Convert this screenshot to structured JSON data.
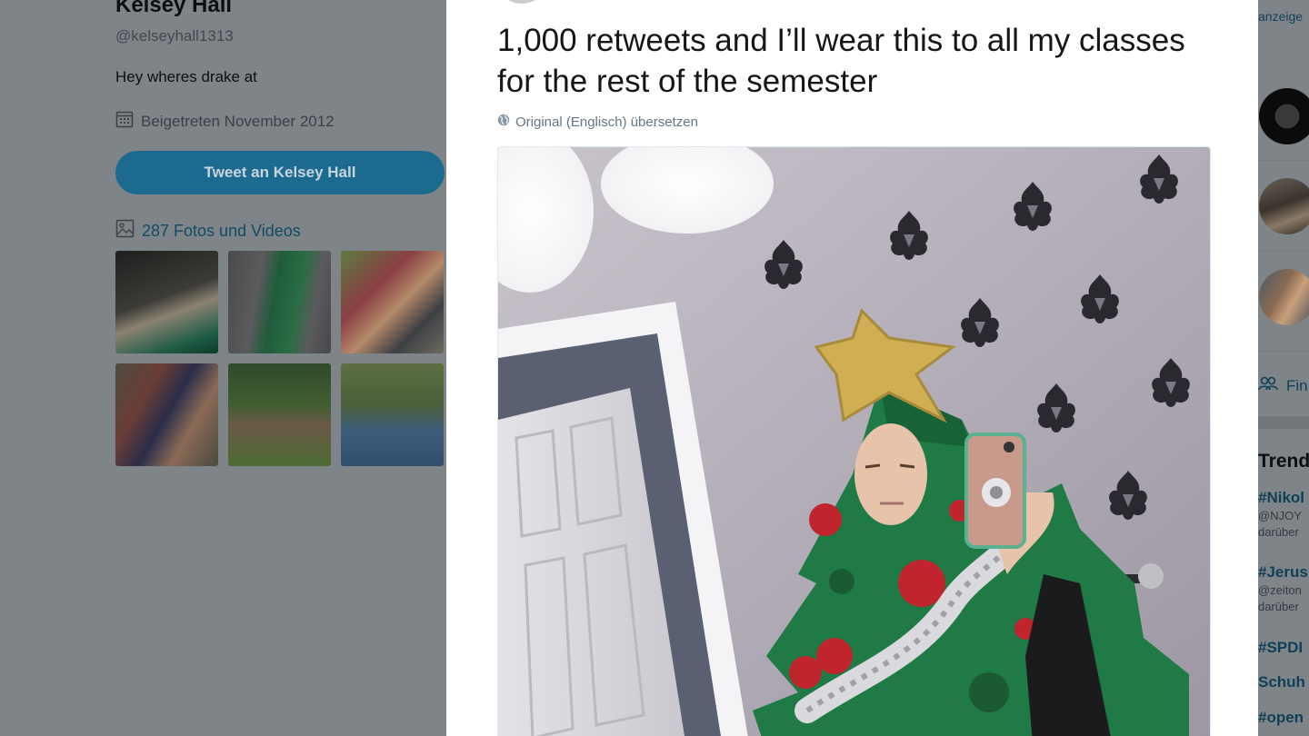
{
  "profile": {
    "name": "Kelsey Hall",
    "handle": "@kelseyhall1313",
    "bio": "Hey wheres drake at",
    "joined": "Beigetreten November 2012",
    "tweet_button": "Tweet an Kelsey Hall",
    "media_link": "287 Fotos und Videos"
  },
  "tweet": {
    "text": "1,000 retweets and I’ll wear this to all my classes for the rest of the semester",
    "translate": "Original (Englisch) übersetzen"
  },
  "sidebar_right": {
    "ads_label": "anzeige",
    "find_label": "Fin",
    "trends_title": "Trend",
    "trends": [
      {
        "tag": "#Nikol",
        "lines": [
          "@NJOY",
          "darüber"
        ]
      },
      {
        "tag": "#Jerus",
        "lines": [
          "@zeiton",
          "darüber"
        ]
      },
      {
        "tag": "#SPDI",
        "lines": []
      },
      {
        "tag": "Schuh",
        "lines": []
      },
      {
        "tag": "#open",
        "lines": []
      }
    ]
  },
  "colors": {
    "overlay": "#7f8489",
    "link_dimmed": "#124a66",
    "button_dimmed": "#1c6a90",
    "modal_bg": "#ffffff"
  }
}
